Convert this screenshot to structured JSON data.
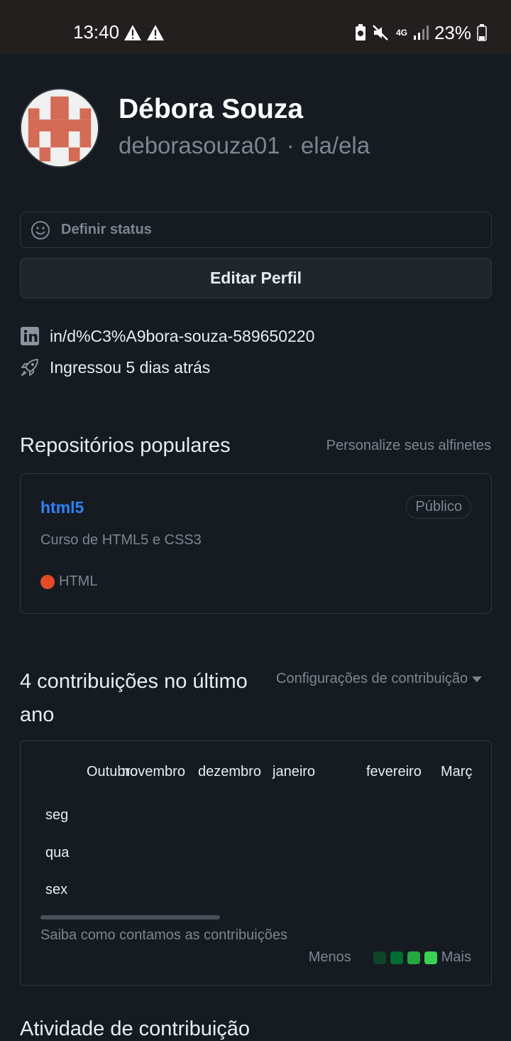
{
  "status_bar": {
    "time": "13:40",
    "network": "4G",
    "battery_pct": "23%"
  },
  "profile": {
    "name": "Débora Souza",
    "login_pronouns": "deborasouza01 · ela/ela",
    "status_placeholder": "Definir status",
    "edit_button": "Editar Perfil",
    "linkedin": "in/d%C3%A9bora-souza-589650220",
    "joined": "Ingressou 5 dias atrás"
  },
  "popular": {
    "title": "Repositórios populares",
    "customize_link": "Personalize seus alfinetes",
    "repos": [
      {
        "name": "html5",
        "visibility": "Público",
        "description": "Curso de HTML5 e CSS3",
        "language": "HTML",
        "language_color": "#e34c26"
      }
    ]
  },
  "contributions": {
    "title": "4 contribuições no último ano",
    "settings_link": "Configurações de contribuição",
    "months": [
      "Outubro",
      "novembro",
      "dezembro",
      "janeiro",
      "fevereiro",
      "Março"
    ],
    "days": [
      "seg",
      "qua",
      "sex"
    ],
    "learn_link": "Saiba como contamos as contribuições",
    "legend_less": "Menos",
    "legend_more": "Mais",
    "legend_colors": [
      "#0e4429",
      "#006d32",
      "#26a641",
      "#39d353"
    ]
  },
  "activity": {
    "title": "Atividade de contribuição"
  }
}
